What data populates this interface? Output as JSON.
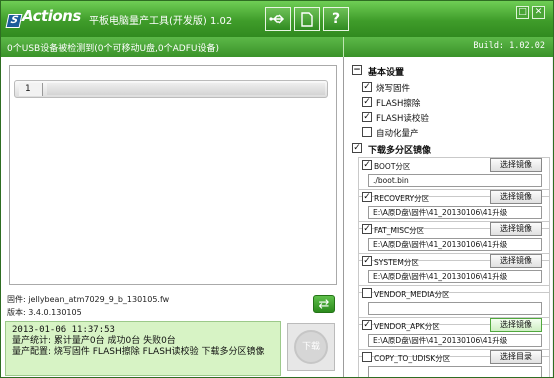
{
  "app": {
    "logo_text": "Actions",
    "title": "平板电脑量产工具(开发版) 1.02"
  },
  "toolbar": {
    "usb_icon": "usb-icon",
    "doc_icon": "document-icon",
    "help_label": "?"
  },
  "window": {
    "restore_glyph": "□",
    "close_glyph": "✕"
  },
  "status": {
    "text": "0个USB设备被检测到(0个可移动U盘,0个ADFU设备)",
    "build": "Build: 1.02.02"
  },
  "device": {
    "slot": "1"
  },
  "firmware": {
    "file_line": "固件: jellybean_atm7029_9_b_130105.fw",
    "version_line": "版本: 3.4.0.130105"
  },
  "log": {
    "time": "2013-01-06 11:37:53",
    "stats": "量产统计: 累计量产0台 成功0台 失败0台",
    "config": "量产配置: 烧写固件 FLASH擦除 FLASH读校验 下载多分区镜像"
  },
  "download_button": "下载",
  "basic": {
    "header": "基本设置",
    "collapse": "−",
    "options": [
      {
        "label": "烧写固件",
        "checked": true
      },
      {
        "label": "FLASH擦除",
        "checked": true
      },
      {
        "label": "FLASH读校验",
        "checked": true
      },
      {
        "label": "自动化量产",
        "checked": false
      }
    ]
  },
  "multi": {
    "header": "下载多分区镜像",
    "checked": true,
    "partitions": [
      {
        "label": "BOOT分区",
        "checked": true,
        "button": "选择镜像",
        "path": "./boot.bin"
      },
      {
        "label": "RECOVERY分区",
        "checked": true,
        "button": "选择镜像",
        "path": "E:\\A原D盘\\固件\\41_20130106\\41升级"
      },
      {
        "label": "FAT_MISC分区",
        "checked": true,
        "button": "选择镜像",
        "path": "E:\\A原D盘\\固件\\41_20130106\\41升级"
      },
      {
        "label": "SYSTEM分区",
        "checked": true,
        "button": "选择镜像",
        "path": "E:\\A原D盘\\固件\\41_20130106\\41升级"
      },
      {
        "label": "VENDOR_MEDIA分区",
        "checked": false,
        "button": "选择镜像",
        "path": ""
      },
      {
        "label": "VENDOR_APK分区",
        "checked": true,
        "button": "选择镜像",
        "path": "E:\\A原D盘\\固件\\41_20130106\\41升级"
      },
      {
        "label": "COPY_TO_UDISK分区",
        "checked": false,
        "button": "选择目录",
        "path": ""
      }
    ]
  },
  "refresh_icon": "refresh-icon"
}
